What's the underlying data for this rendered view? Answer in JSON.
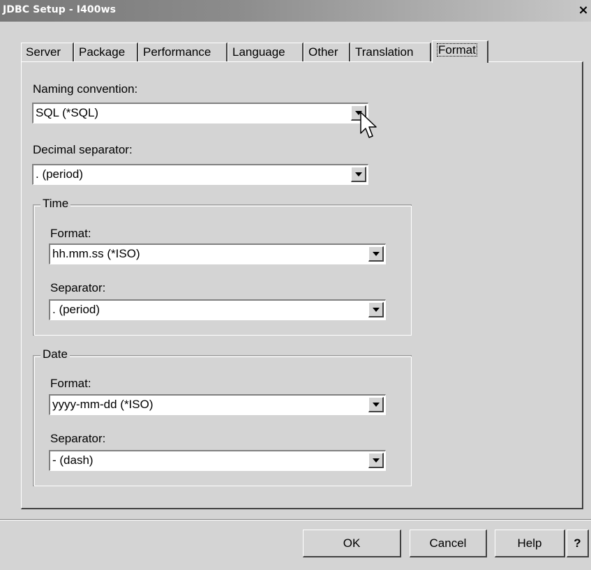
{
  "window": {
    "title": "JDBC Setup - I400ws",
    "close_glyph": "×"
  },
  "tabs": [
    {
      "label": "Server"
    },
    {
      "label": "Package"
    },
    {
      "label": "Performance"
    },
    {
      "label": "Language"
    },
    {
      "label": "Other"
    },
    {
      "label": "Translation"
    },
    {
      "label": "Format",
      "active": true
    }
  ],
  "form": {
    "naming_convention": {
      "label": "Naming convention:",
      "value": "SQL (*SQL)"
    },
    "decimal_separator": {
      "label": "Decimal separator:",
      "value": ". (period)"
    }
  },
  "time_group": {
    "title": "Time",
    "format": {
      "label": "Format:",
      "value": "hh.mm.ss  (*ISO)"
    },
    "separator": {
      "label": "Separator:",
      "value": ".  (period)"
    }
  },
  "date_group": {
    "title": "Date",
    "format": {
      "label": "Format:",
      "value": "yyyy-mm-dd  (*ISO)"
    },
    "separator": {
      "label": "Separator:",
      "value": "-  (dash)"
    }
  },
  "buttons": {
    "ok": "OK",
    "cancel": "Cancel",
    "help": "Help",
    "context_help": "?"
  },
  "icons": {
    "dropdown": "chevron-down-icon",
    "pointer": "mouse-pointer-icon"
  }
}
